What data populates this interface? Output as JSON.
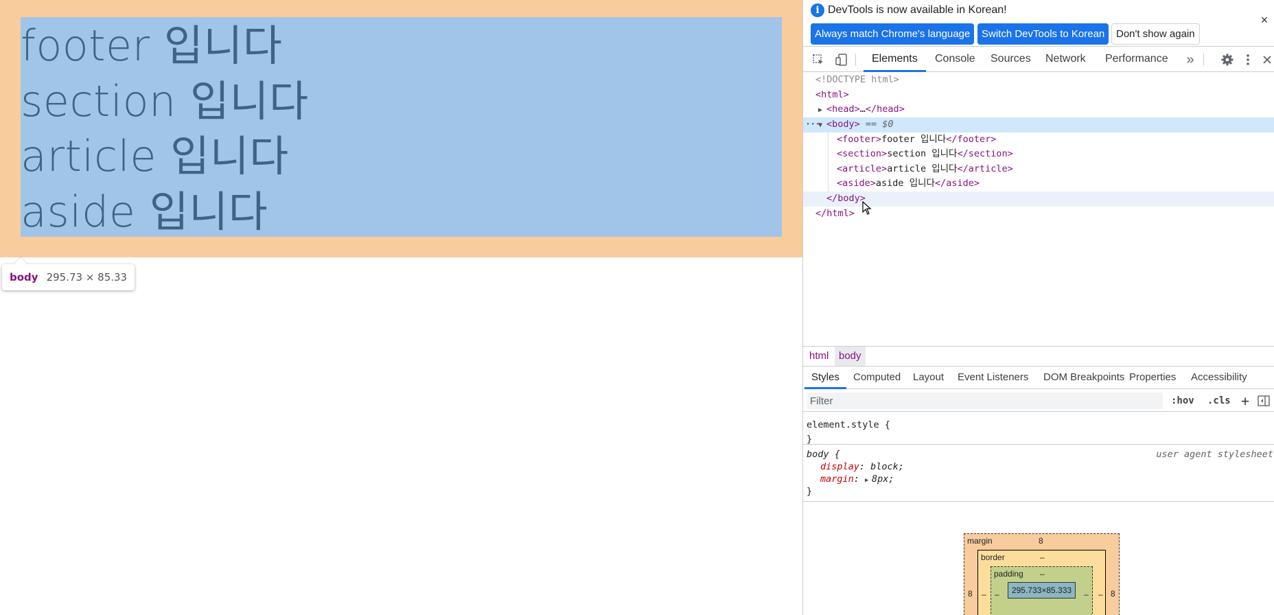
{
  "page": {
    "lines": [
      "footer 입니다",
      "section 입니다",
      "article 입니다",
      "aside 입니다"
    ],
    "tooltip": {
      "tag": "body",
      "size": "295.73 × 85.33"
    }
  },
  "devtools": {
    "infobar": {
      "message": "DevTools is now available in Korean!",
      "btn_match": "Always match Chrome's language",
      "btn_switch": "Switch DevTools to Korean",
      "btn_dont_show": "Don't show again",
      "close": "×"
    },
    "main_tabs": [
      "Elements",
      "Console",
      "Sources",
      "Network",
      "Performance"
    ],
    "more_tabs": "»",
    "dom": {
      "doctype": "<!DOCTYPE html>",
      "html_open": "<html>",
      "head_open": "<head>",
      "head_ellipsis": "…",
      "head_close": "</head>",
      "body_open": "<body>",
      "selected_marker": "== $0",
      "dots": "···",
      "children": [
        {
          "tag": "footer",
          "text": "footer 입니다"
        },
        {
          "tag": "section",
          "text": "section 입니다"
        },
        {
          "tag": "article",
          "text": "article 입니다"
        },
        {
          "tag": "aside",
          "text": "aside 입니다"
        }
      ],
      "body_close": "</body>",
      "html_close": "</html>"
    },
    "breadcrumbs": [
      "html",
      "body"
    ],
    "sub_tabs": [
      "Styles",
      "Computed",
      "Layout",
      "Event Listeners",
      "DOM Breakpoints",
      "Properties",
      "Accessibility"
    ],
    "filter": {
      "placeholder": "Filter",
      "hov": ":hov",
      "cls": ".cls",
      "plus": "+"
    },
    "styles": {
      "element_style_selector": "element.style {",
      "close_brace": "}",
      "body_selector": "body {",
      "origin": "user agent stylesheet",
      "props": [
        {
          "name": "display",
          "value": "block;"
        },
        {
          "name": "margin",
          "value": "8px;"
        }
      ]
    },
    "box_model": {
      "margin_label": "margin",
      "margin_top": "8",
      "margin_left": "8",
      "margin_right": "8",
      "border_label": "border",
      "border_top": "–",
      "border_left": "–",
      "border_right": "–",
      "padding_label": "padding",
      "padding_top": "–",
      "padding_bottom": "–",
      "padding_left": "–",
      "padding_right": "–",
      "content": "295.733×85.333"
    },
    "colors": {
      "accent": "#1a73e8",
      "margin_highlight": "#f9cc9d",
      "content_highlight": "#a0c5e8",
      "tag": "#881280"
    }
  }
}
